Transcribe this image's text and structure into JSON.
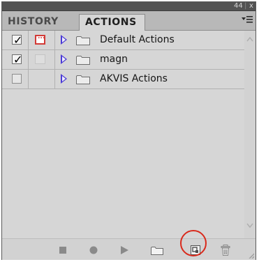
{
  "window": {
    "collapse_glyph": "44",
    "separator_glyph": "|",
    "close_glyph": "x"
  },
  "tabs": [
    {
      "label": "HISTORY",
      "active": false
    },
    {
      "label": "ACTIONS",
      "active": true
    }
  ],
  "panel_menu_icon": "panel-menu-icon",
  "action_sets": [
    {
      "label": "Default Actions",
      "enabled": true,
      "dialog_on": true
    },
    {
      "label": "magn",
      "enabled": true,
      "dialog_on": false
    },
    {
      "label": "AKVIS Actions",
      "enabled": false,
      "dialog_on": false
    }
  ],
  "toolbar": {
    "buttons": [
      {
        "name": "stop-button",
        "icon": "stop-icon"
      },
      {
        "name": "record-button",
        "icon": "record-icon"
      },
      {
        "name": "play-button",
        "icon": "play-icon"
      },
      {
        "name": "new-set-button",
        "icon": "folder-icon"
      },
      {
        "name": "new-action-button",
        "icon": "new-action-icon"
      },
      {
        "name": "delete-button",
        "icon": "trash-icon"
      }
    ]
  },
  "colors": {
    "disclosure": "#4b3ad6",
    "dialog_toggle": "#d23a36",
    "highlight_ring": "#d92a1c"
  }
}
